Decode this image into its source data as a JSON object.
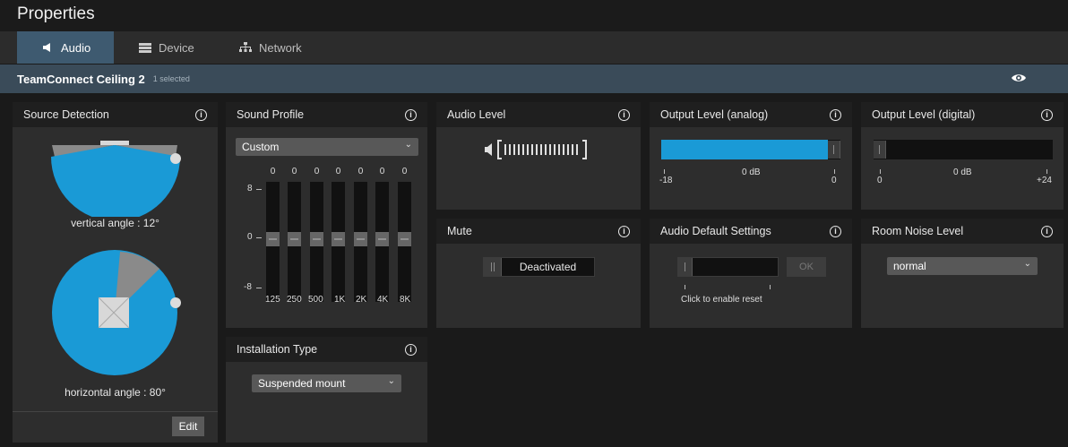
{
  "window": {
    "title": "Properties"
  },
  "tabs": [
    {
      "label": "Audio",
      "icon": "speaker-icon",
      "active": true
    },
    {
      "label": "Device",
      "icon": "device-icon",
      "active": false
    },
    {
      "label": "Network",
      "icon": "network-icon",
      "active": false
    }
  ],
  "device": {
    "name": "TeamConnect Ceiling 2",
    "selected": "1 selected"
  },
  "source_detection": {
    "title": "Source Detection",
    "vertical_label": "vertical angle : 12°",
    "horizontal_label": "horizontal angle : 80°",
    "edit_label": "Edit",
    "vertical_angle_deg": 12,
    "horizontal_angle_deg": 80
  },
  "sound_profile": {
    "title": "Sound Profile",
    "preset": "Custom",
    "scale_top": "8",
    "scale_mid": "0",
    "scale_bottom": "-8",
    "bands": [
      {
        "freq": "125",
        "value": "0"
      },
      {
        "freq": "250",
        "value": "0"
      },
      {
        "freq": "500",
        "value": "0"
      },
      {
        "freq": "1K",
        "value": "0"
      },
      {
        "freq": "2K",
        "value": "0"
      },
      {
        "freq": "4K",
        "value": "0"
      },
      {
        "freq": "8K",
        "value": "0"
      }
    ]
  },
  "installation_type": {
    "title": "Installation Type",
    "value": "Suspended mount"
  },
  "audio_level": {
    "title": "Audio Level"
  },
  "mute": {
    "title": "Mute",
    "state": "Deactivated"
  },
  "output_analog": {
    "title": "Output Level (analog)",
    "value_label": "0 dB",
    "min": "-18",
    "max": "0",
    "level_fraction": 1.0
  },
  "output_digital": {
    "title": "Output Level (digital)",
    "value_label": "0 dB",
    "min": "0",
    "max": "+24",
    "level_fraction": 0.0
  },
  "audio_default": {
    "title": "Audio Default Settings",
    "ok_label": "OK",
    "hint": "Click to enable reset"
  },
  "room_noise": {
    "title": "Room Noise Level",
    "value": "normal"
  },
  "colors": {
    "accent": "#1a9ad6",
    "tab_active": "#3e5a70",
    "device_bar": "#3a4b59",
    "panel": "#2d2d2d"
  }
}
